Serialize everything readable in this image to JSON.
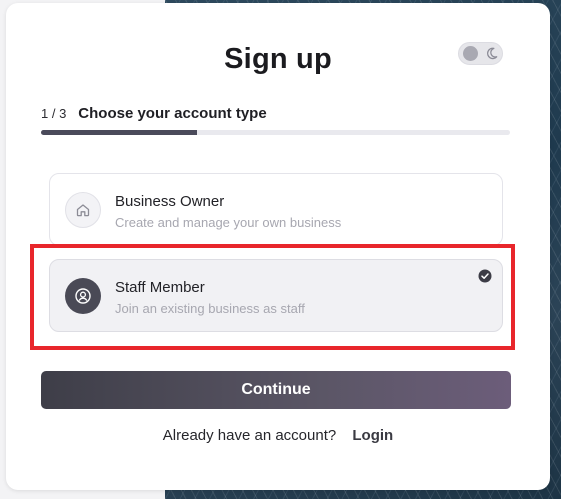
{
  "header": {
    "title": "Sign up"
  },
  "theme_toggle": {
    "mode": "light",
    "knob_icon": "circle-icon",
    "alt_icon": "moon-icon"
  },
  "step": {
    "count": "1 / 3",
    "title": "Choose your account type",
    "progress_fraction": 0.333
  },
  "options": [
    {
      "id": "business-owner",
      "title": "Business Owner",
      "description": "Create and manage your own business",
      "icon": "home-icon",
      "selected": false
    },
    {
      "id": "staff-member",
      "title": "Staff Member",
      "description": "Join an existing business as staff",
      "icon": "user-circle-icon",
      "selected": true,
      "selected_icon": "check-circle-icon"
    }
  ],
  "continue_label": "Continue",
  "footer": {
    "prompt": "Already have an account?",
    "login_label": "Login"
  },
  "colors": {
    "highlight": "#e8262b",
    "primary_start": "#3e3e48",
    "primary_end": "#6c5d7a"
  }
}
